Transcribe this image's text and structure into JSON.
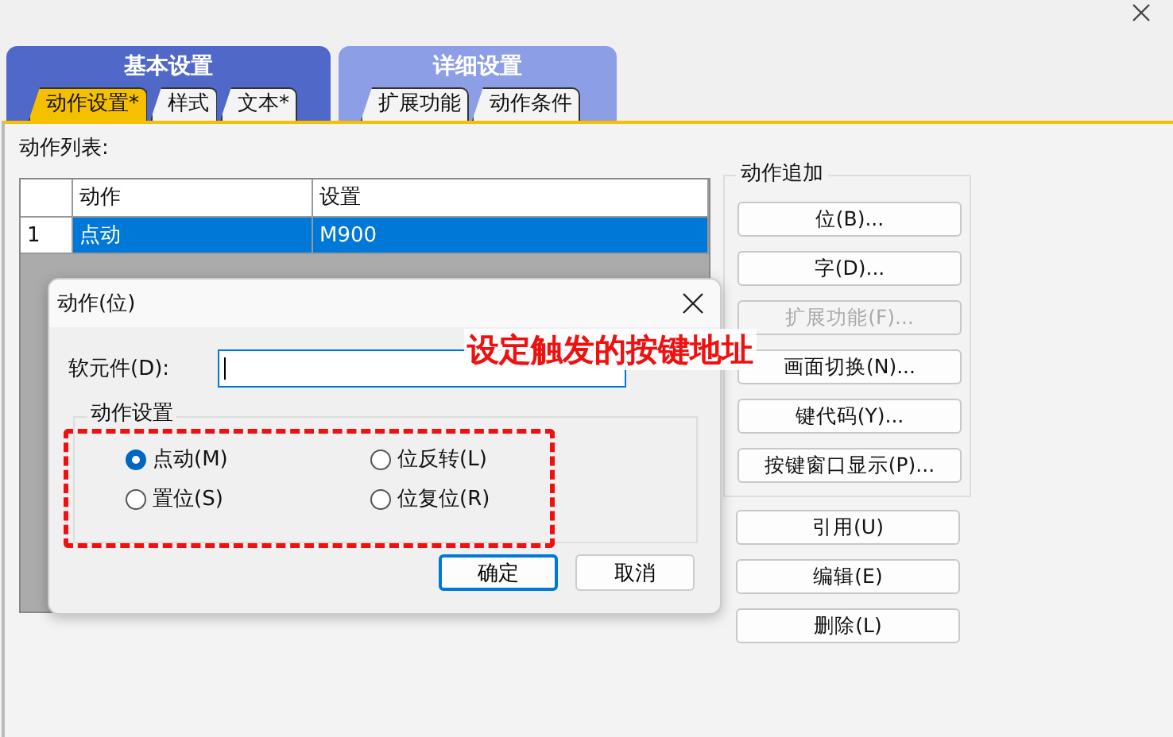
{
  "main_tabs": [
    {
      "label": "基本设置",
      "selected": true,
      "subtabs": [
        {
          "label": "动作设置*",
          "selected": true
        },
        {
          "label": "样式",
          "selected": false
        },
        {
          "label": "文本*",
          "selected": false
        }
      ]
    },
    {
      "label": "详细设置",
      "selected": false,
      "subtabs": [
        {
          "label": "扩展功能",
          "selected": false
        },
        {
          "label": "动作条件",
          "selected": false
        }
      ]
    }
  ],
  "action_list": {
    "label": "动作列表:",
    "columns": [
      "动作",
      "设置"
    ],
    "rows": [
      {
        "index": "1",
        "cells": [
          "点动",
          "M900"
        ],
        "selected": true
      }
    ]
  },
  "action_add": {
    "title": "动作追加",
    "buttons": [
      {
        "label": "位(B)...",
        "disabled": false
      },
      {
        "label": "字(D)...",
        "disabled": false
      },
      {
        "label": "扩展功能(F)...",
        "disabled": true
      },
      {
        "label": "画面切换(N)...",
        "disabled": false
      },
      {
        "label": "键代码(Y)...",
        "disabled": false
      },
      {
        "label": "按键窗口显示(P)...",
        "disabled": false
      }
    ]
  },
  "list_buttons": [
    {
      "label": "引用(U)",
      "disabled": false
    },
    {
      "label": "编辑(E)",
      "disabled": false
    },
    {
      "label": "删除(L)",
      "disabled": false
    }
  ],
  "dialog": {
    "title": "动作(位)",
    "device_label": "软元件(D):",
    "group_title": "动作设置",
    "options": [
      {
        "label": "点动(M)",
        "selected": true
      },
      {
        "label": "位反转(L)",
        "selected": false
      },
      {
        "label": "置位(S)",
        "selected": false
      },
      {
        "label": "位复位(R)",
        "selected": false
      }
    ],
    "buttons": [
      {
        "label": "确定",
        "default": true
      },
      {
        "label": "取消",
        "default": false
      }
    ]
  },
  "annotation": {
    "text": "设定触发的按键地址"
  }
}
